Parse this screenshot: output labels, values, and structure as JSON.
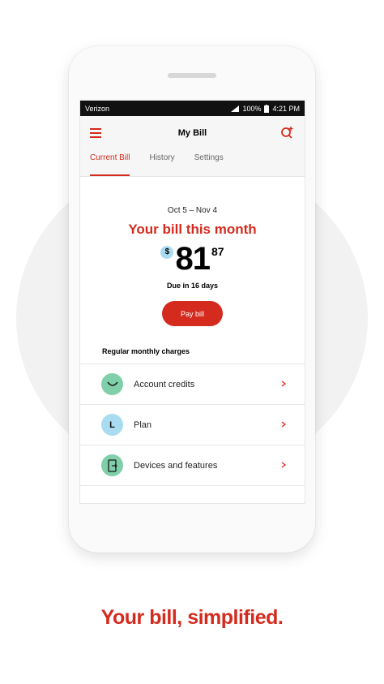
{
  "status_bar": {
    "carrier": "Verizon",
    "battery": "100%",
    "time": "4:21 PM"
  },
  "header": {
    "title": "My Bill"
  },
  "tabs": [
    {
      "label": "Current Bill",
      "active": true
    },
    {
      "label": "History",
      "active": false
    },
    {
      "label": "Settings",
      "active": false
    }
  ],
  "bill": {
    "period": "Oct 5  –  Nov 4",
    "headline": "Your bill this month",
    "currency_symbol": "$",
    "amount_dollars": "81",
    "amount_cents": "87",
    "due": "Due in 16 days",
    "pay_label": "Pay bill"
  },
  "charges": {
    "title": "Regular monthly charges",
    "items": [
      {
        "label": "Account credits",
        "icon": "smile-icon",
        "color": "#7fcfaa"
      },
      {
        "label": "Plan",
        "icon": "letter-l-icon",
        "badge": "L",
        "color": "#a9dcf0"
      },
      {
        "label": "Devices and features",
        "icon": "device-icon",
        "color": "#7fcfaa"
      }
    ]
  },
  "tagline": "Your bill, simplified.",
  "colors": {
    "accent": "#d52b1e",
    "mint": "#7fcfaa",
    "sky": "#a9dcf0"
  }
}
